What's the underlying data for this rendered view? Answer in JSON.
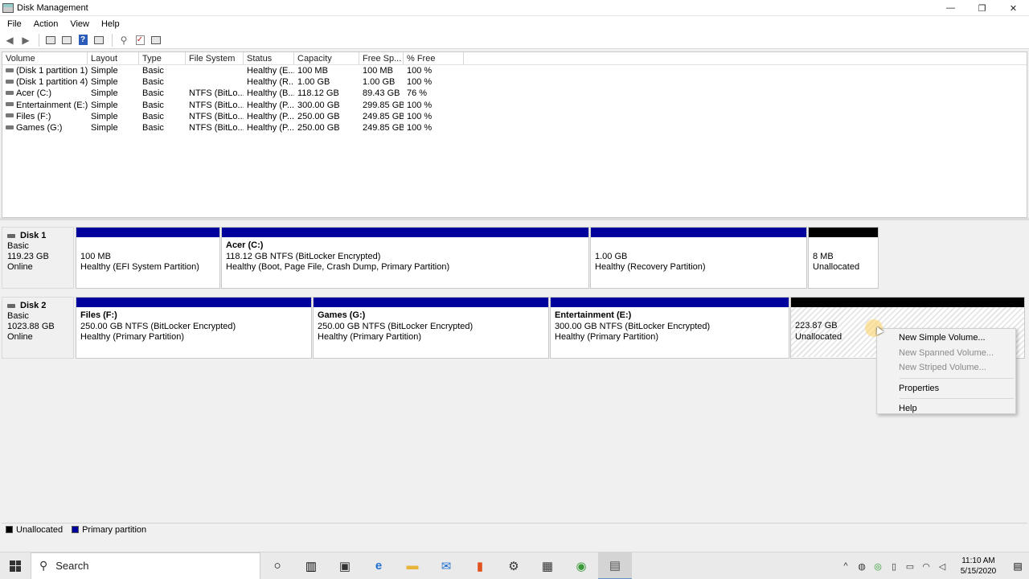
{
  "window": {
    "title": "Disk Management",
    "minimize": "—",
    "restore": "❐",
    "close": "✕"
  },
  "menu": [
    "File",
    "Action",
    "View",
    "Help"
  ],
  "volume_list": {
    "columns": [
      "Volume",
      "Layout",
      "Type",
      "File System",
      "Status",
      "Capacity",
      "Free Sp...",
      "% Free"
    ],
    "rows": [
      [
        "(Disk 1 partition 1)",
        "Simple",
        "Basic",
        "",
        "Healthy (E...",
        "100 MB",
        "100 MB",
        "100 %"
      ],
      [
        "(Disk 1 partition 4)",
        "Simple",
        "Basic",
        "",
        "Healthy (R...",
        "1.00 GB",
        "1.00 GB",
        "100 %"
      ],
      [
        "Acer (C:)",
        "Simple",
        "Basic",
        "NTFS (BitLo...",
        "Healthy (B...",
        "118.12 GB",
        "89.43 GB",
        "76 %"
      ],
      [
        "Entertainment (E:)",
        "Simple",
        "Basic",
        "NTFS (BitLo...",
        "Healthy (P...",
        "300.00 GB",
        "299.85 GB",
        "100 %"
      ],
      [
        "Files (F:)",
        "Simple",
        "Basic",
        "NTFS (BitLo...",
        "Healthy (P...",
        "250.00 GB",
        "249.85 GB",
        "100 %"
      ],
      [
        "Games (G:)",
        "Simple",
        "Basic",
        "NTFS (BitLo...",
        "Healthy (P...",
        "250.00 GB",
        "249.85 GB",
        "100 %"
      ]
    ]
  },
  "disk1": {
    "name": "Disk 1",
    "type": "Basic",
    "size": "119.23 GB",
    "state": "Online",
    "partitions": {
      "p1": {
        "name": "",
        "line1": "100 MB",
        "line2": "Healthy (EFI System Partition)"
      },
      "p2": {
        "name": "Acer  (C:)",
        "line1": "118.12 GB NTFS (BitLocker Encrypted)",
        "line2": "Healthy (Boot, Page File, Crash Dump, Primary Partition)"
      },
      "p3": {
        "name": "",
        "line1": "1.00 GB",
        "line2": "Healthy (Recovery Partition)"
      },
      "p4": {
        "name": "",
        "line1": "8 MB",
        "line2": "Unallocated"
      }
    }
  },
  "disk2": {
    "name": "Disk 2",
    "type": "Basic",
    "size": "1023.88 GB",
    "state": "Online",
    "partitions": {
      "p1": {
        "name": "Files  (F:)",
        "line1": "250.00 GB NTFS (BitLocker Encrypted)",
        "line2": "Healthy (Primary Partition)"
      },
      "p2": {
        "name": "Games  (G:)",
        "line1": "250.00 GB NTFS (BitLocker Encrypted)",
        "line2": "Healthy (Primary Partition)"
      },
      "p3": {
        "name": "Entertainment  (E:)",
        "line1": "300.00 GB NTFS (BitLocker Encrypted)",
        "line2": "Healthy (Primary Partition)"
      },
      "p4": {
        "name": "",
        "line1": "223.87 GB",
        "line2": "Unallocated"
      }
    }
  },
  "context_menu": {
    "new_simple": "New Simple Volume...",
    "new_spanned": "New Spanned Volume...",
    "new_striped": "New Striped Volume...",
    "properties": "Properties",
    "help": "Help"
  },
  "legend": {
    "unallocated": "Unallocated",
    "primary": "Primary partition",
    "unallocated_color": "#000000",
    "primary_color": "#00009c"
  },
  "taskbar": {
    "search_label": "Search",
    "time": "11:10 AM",
    "date": "5/15/2020"
  }
}
